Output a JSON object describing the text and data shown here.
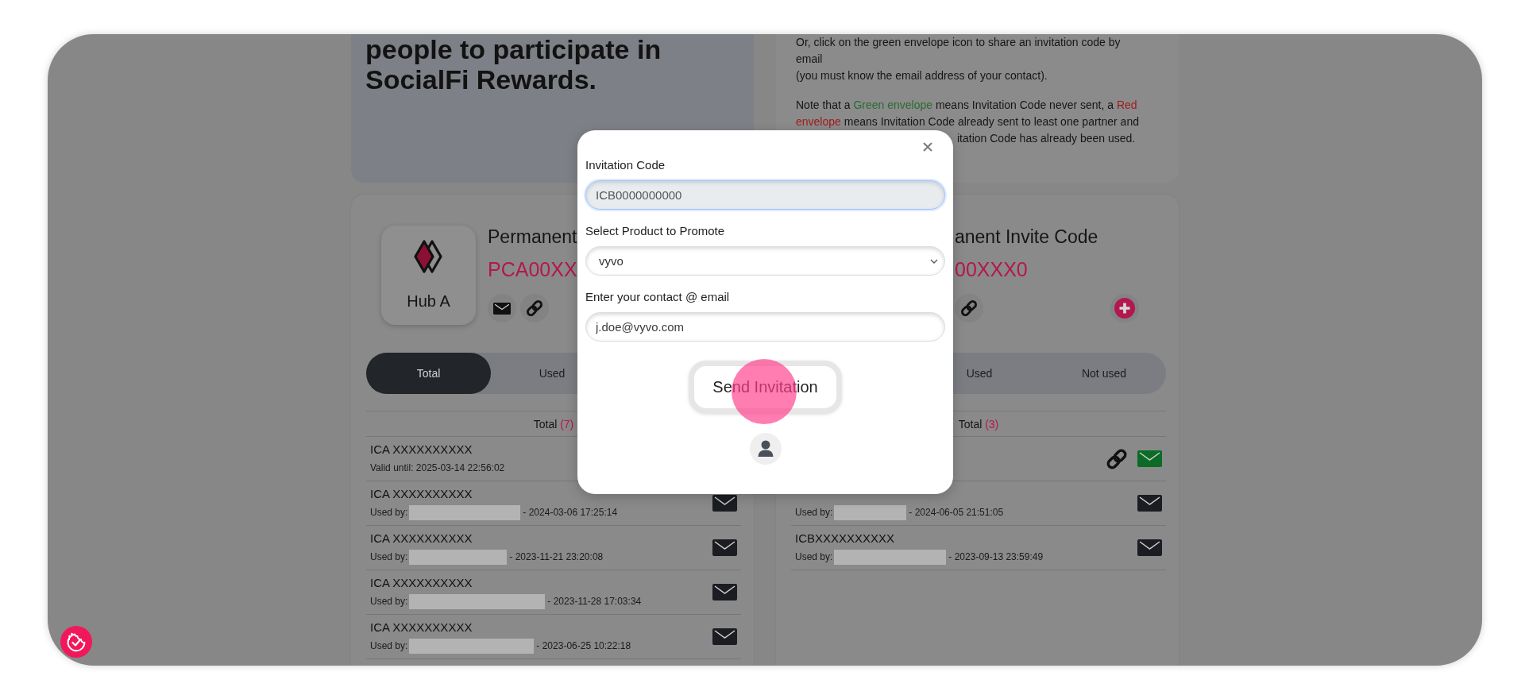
{
  "intro": {
    "lines": [
      "people to participate in",
      "SocialFi Rewards."
    ]
  },
  "instructions": {
    "lines": [
      "Or, click on the green envelope icon to share an invitation code by",
      "email",
      "(you must know the email address of your contact)."
    ],
    "note_lines": [
      [
        {
          "text": "Note that a "
        },
        {
          "text": "Green envelope",
          "color": "#2a6b34"
        },
        {
          "text": " means Invitation Code never sent, a "
        },
        {
          "text": "Red",
          "color": "#a11c1c"
        }
      ],
      [
        {
          "text": "envelope",
          "color": "#a11c1c"
        },
        {
          "text": " means Invitation Code already sent to least one partner and"
        }
      ]
    ],
    "note_fragment": "itation Code has already been used."
  },
  "cards": [
    {
      "hub": {
        "label": "Hub A"
      },
      "title": "Permanent",
      "code": "PCA00XX",
      "actions": [
        {
          "kind": "email"
        },
        {
          "kind": "link"
        }
      ],
      "tabs": [
        {
          "label": "Total",
          "selected": true
        },
        {
          "label": "Used",
          "selected": false
        }
      ],
      "list_heading": {
        "label": "Total",
        "count": "(7)"
      },
      "rows": [
        {
          "kind": "valid",
          "code": "ICA XXXXXXXXXX",
          "detail": "Valid until: 2025-03-14 22:56:02",
          "link": false
        },
        {
          "kind": "used",
          "code": "ICA XXXXXXXXXX",
          "label": "Used by:",
          "date": "- 2024-03-06 17:25:14",
          "color": "#1b1d22",
          "link": false
        },
        {
          "kind": "used",
          "code": "ICA XXXXXXXXXX",
          "label": "Used by:",
          "date": "- 2023-11-21 23:20:08",
          "color": "#1b1d22",
          "link": false
        },
        {
          "kind": "used",
          "code": "ICA XXXXXXXXXX",
          "label": "Used by:",
          "date": "- 2023-11-28 17:03:34",
          "color": "#1b1d22",
          "link": false
        },
        {
          "kind": "used",
          "code": "ICA XXXXXXXXXX",
          "label": "Used by:",
          "date": "- 2023-06-25 10:22:18",
          "color": "#1b1d22",
          "link": false
        }
      ]
    },
    {
      "title": "anent Invite Code",
      "code": "00XXX0",
      "actions": [
        {
          "kind": "link"
        },
        {
          "kind": "add"
        }
      ],
      "tabs": [
        {
          "label": "Used",
          "selected": false
        },
        {
          "label": "Not used",
          "selected": false
        }
      ],
      "list_heading": {
        "label": "Total",
        "count": "(3)"
      },
      "rows": [
        {
          "kind": "covered",
          "color": "#0c6b26",
          "link": true
        },
        {
          "kind": "used",
          "label": "Used by:",
          "date": "- 2024-06-05 21:51:05",
          "color": "#1b1d22",
          "link": false
        },
        {
          "kind": "used",
          "code": "ICBXXXXXXXXXX",
          "label": "Used by:",
          "date": "- 2023-09-13 23:59:49",
          "color": "#1b1d22",
          "link": false
        }
      ]
    }
  ],
  "modal": {
    "fields": [
      {
        "kind": "input",
        "label": "Invitation Code",
        "value": "ICB0000000000",
        "readonly": true,
        "focused": true
      },
      {
        "kind": "select",
        "label": "Select Product to Promote",
        "value": "vyvo",
        "readonly": false,
        "focused": false
      },
      {
        "kind": "input",
        "label": "Enter your contact @ email",
        "value": "j.doe@vyvo.com",
        "readonly": false,
        "focused": false
      }
    ],
    "submit": "Send Invitation"
  }
}
